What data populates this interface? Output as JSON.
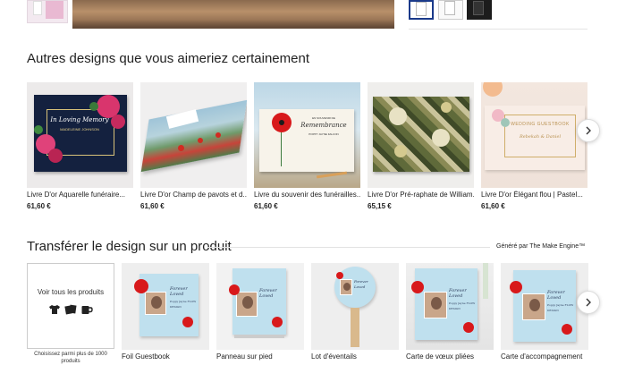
{
  "colors": {
    "accent_blue": "#1a3a8a",
    "text": "#222222",
    "poppy_red": "#d8191b",
    "memorial_blue": "#bfe0ee"
  },
  "section_similar": {
    "title": "Autres designs que vous aimeriez certainement",
    "next_icon": "chevron-right-icon",
    "items": [
      {
        "name": "Livre D'or Aquarelle funéraire...",
        "price": "61,60 €",
        "cover_script": "In Loving Memory",
        "cover_name": "MADELEINE JOHNSON"
      },
      {
        "name": "Livre D'or Champ de pavots et d...",
        "price": "61,60 €",
        "cover_script": "Celebrating the life"
      },
      {
        "name": "Livre du souvenir des funérailles...",
        "price": "61,60 €",
        "cover_small": "EN SOUVENIR DE",
        "cover_script": "Remembrance",
        "cover_name": "POPPY JAYNE FALCON"
      },
      {
        "name": "Livre D'or Pré-raphate de William...",
        "price": "65,15 €"
      },
      {
        "name": "Livre D'or Élégant flou | Pastel...",
        "price": "61,60 €",
        "cover_title": "WEDDING GUESTBOOK",
        "cover_script": "Rebekah & Daniel"
      }
    ]
  },
  "section_transfer": {
    "title": "Transférer le design sur un produit",
    "generated_by": "Généré par The Make Engine™",
    "view_all": {
      "label": "Voir tous les produits",
      "caption": "Choisissez parmi plus de 1000 produits"
    },
    "memorial_text": {
      "script": "Forever Loved",
      "name": "Poppy Jayne FLOW DESIGN"
    },
    "products": [
      {
        "name": "Foil Guestbook"
      },
      {
        "name": "Panneau sur pied"
      },
      {
        "name": "Lot d'éventails"
      },
      {
        "name": "Carte de vœux pliées"
      },
      {
        "name": "Carte d'accompagnement"
      }
    ]
  }
}
